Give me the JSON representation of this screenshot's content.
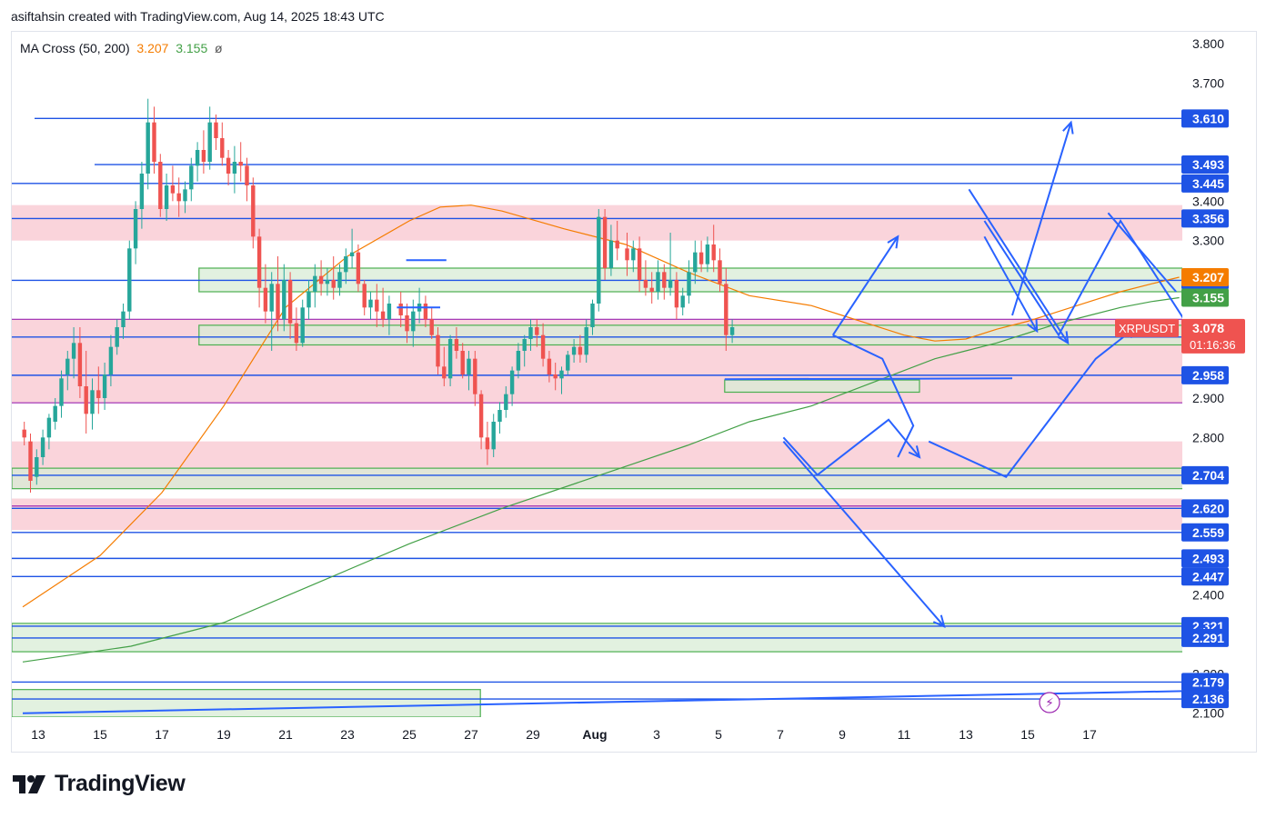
{
  "header": {
    "text": "asiftahsin created with TradingView.com, Aug 14, 2025 18:43 UTC"
  },
  "indicator": {
    "name": "MA Cross (50, 200)",
    "ma50": "3.207",
    "ma200": "3.155",
    "symbol": "ø"
  },
  "brand": {
    "name": "TradingView"
  },
  "colors": {
    "up": "#26a69a",
    "down": "#ef5350",
    "hline": "#1e53e5",
    "ma50": "#f57c00",
    "ma200": "#43a047",
    "redzone": "#f8c6cf",
    "greenzone": "#d8ecd6"
  },
  "chart_data": {
    "type": "candlestick",
    "symbol": "XRPUSDT",
    "last_price": "3.078",
    "countdown": "01:16:36",
    "ylim": [
      2.09,
      3.83
    ],
    "y_ticks": [
      "3.800",
      "3.700",
      "3.400",
      "3.300",
      "2.900",
      "2.800",
      "2.400",
      "2.300",
      "2.200",
      "2.100"
    ],
    "x_ticks": [
      "13",
      "15",
      "17",
      "19",
      "21",
      "23",
      "25",
      "27",
      "29",
      "Aug",
      "3",
      "5",
      "7",
      "9",
      "11",
      "13",
      "15",
      "17"
    ],
    "horizontal_levels": [
      {
        "value": "3.610",
        "y": 3.61
      },
      {
        "value": "3.493",
        "y": 3.493
      },
      {
        "value": "3.445",
        "y": 3.445
      },
      {
        "value": "3.356",
        "y": 3.356
      },
      {
        "value": "3.199",
        "y": 3.199
      },
      {
        "value": "3.055",
        "y": 3.055
      },
      {
        "value": "2.958",
        "y": 2.958
      },
      {
        "value": "2.704",
        "y": 2.704
      },
      {
        "value": "2.620",
        "y": 2.62
      },
      {
        "value": "2.559",
        "y": 2.559
      },
      {
        "value": "2.493",
        "y": 2.493
      },
      {
        "value": "2.447",
        "y": 2.447
      },
      {
        "value": "2.321",
        "y": 2.321
      },
      {
        "value": "2.291",
        "y": 2.291
      },
      {
        "value": "2.179",
        "y": 2.179
      },
      {
        "value": "2.136",
        "y": 2.136
      }
    ],
    "ma_labels": [
      {
        "value": "3.207",
        "y": 3.207,
        "color": "#f57c00"
      },
      {
        "value": "3.155",
        "y": 3.155,
        "color": "#43a047"
      }
    ],
    "zones": [
      {
        "kind": "red",
        "from": 3.3,
        "to": 3.39,
        "x0": 0,
        "x1": 50.8
      },
      {
        "kind": "green",
        "from": 3.17,
        "to": 3.23,
        "x0": 5.2,
        "x1": 50.8
      },
      {
        "kind": "red",
        "from": 2.888,
        "to": 3.1,
        "x0": 0,
        "x1": 50.8
      },
      {
        "kind": "green",
        "from": 3.035,
        "to": 3.085,
        "x0": 5.2,
        "x1": 50.8
      },
      {
        "kind": "green",
        "from": 2.915,
        "to": 2.946,
        "x0": 22.2,
        "x1": 28.5
      },
      {
        "kind": "red",
        "from": 2.67,
        "to": 2.79,
        "x0": 0,
        "x1": 37.6
      },
      {
        "kind": "green",
        "from": 2.67,
        "to": 2.722,
        "x0": 0,
        "x1": 37.6
      },
      {
        "kind": "red",
        "from": 2.565,
        "to": 2.645,
        "x0": 0,
        "x1": 50.8
      },
      {
        "kind": "green",
        "from": 2.256,
        "to": 2.328,
        "x0": 0,
        "x1": 50.8
      },
      {
        "kind": "green",
        "from": 2.09,
        "to": 2.16,
        "x0": 0,
        "x1": 14.3
      }
    ],
    "ma50": [
      [
        -0.5,
        2.37
      ],
      [
        2,
        2.5
      ],
      [
        4,
        2.66
      ],
      [
        6,
        2.88
      ],
      [
        8,
        3.13
      ],
      [
        10,
        3.26
      ],
      [
        12,
        3.35
      ],
      [
        13,
        3.385
      ],
      [
        14,
        3.39
      ],
      [
        15,
        3.375
      ],
      [
        17,
        3.33
      ],
      [
        19,
        3.29
      ],
      [
        21,
        3.22
      ],
      [
        23,
        3.16
      ],
      [
        25,
        3.135
      ],
      [
        26,
        3.11
      ],
      [
        27,
        3.085
      ],
      [
        28,
        3.06
      ],
      [
        29,
        3.045
      ],
      [
        30,
        3.05
      ],
      [
        31,
        3.075
      ],
      [
        32,
        3.095
      ],
      [
        33,
        3.12
      ],
      [
        34,
        3.145
      ],
      [
        35,
        3.17
      ],
      [
        36,
        3.19
      ],
      [
        36.9,
        3.207
      ]
    ],
    "ma200": [
      [
        -0.5,
        2.23
      ],
      [
        3,
        2.27
      ],
      [
        6,
        2.33
      ],
      [
        9,
        2.43
      ],
      [
        12,
        2.53
      ],
      [
        15,
        2.62
      ],
      [
        18,
        2.7
      ],
      [
        21,
        2.78
      ],
      [
        23,
        2.84
      ],
      [
        25,
        2.88
      ],
      [
        26,
        2.91
      ],
      [
        27,
        2.94
      ],
      [
        28,
        2.97
      ],
      [
        29,
        3.0
      ],
      [
        30,
        3.02
      ],
      [
        31,
        3.04
      ],
      [
        32,
        3.065
      ],
      [
        33,
        3.09
      ],
      [
        34,
        3.11
      ],
      [
        35,
        3.13
      ],
      [
        36,
        3.145
      ],
      [
        36.9,
        3.155
      ]
    ],
    "arrows": [
      {
        "kind": "polyline",
        "points": [
          [
            22.2,
            2.948
          ],
          [
            31.5,
            2.95
          ]
        ]
      },
      {
        "kind": "line",
        "points": [
          [
            11.9,
            3.25
          ],
          [
            13.2,
            3.25
          ]
        ]
      },
      {
        "kind": "line",
        "points": [
          [
            11.6,
            3.13
          ],
          [
            13.0,
            3.13
          ]
        ]
      },
      {
        "kind": "polyline",
        "points": [
          [
            24.1,
            2.8
          ],
          [
            25.2,
            2.705
          ],
          [
            27.5,
            2.845
          ],
          [
            28.5,
            2.75
          ]
        ],
        "head": true
      },
      {
        "kind": "polyline",
        "points": [
          [
            25.7,
            3.06
          ],
          [
            27.8,
            3.31
          ]
        ],
        "head": true
      },
      {
        "kind": "polyline",
        "points": [
          [
            27.8,
            2.75
          ],
          [
            28.3,
            2.83
          ],
          [
            27.3,
            3.0
          ],
          [
            25.7,
            3.06
          ]
        ]
      },
      {
        "kind": "polyline",
        "points": [
          [
            28.8,
            2.79
          ],
          [
            31.3,
            2.7
          ],
          [
            34.2,
            3.0
          ],
          [
            35.5,
            3.08
          ]
        ],
        "head": true
      },
      {
        "kind": "polyline",
        "points": [
          [
            30.1,
            3.43
          ],
          [
            33.3,
            3.04
          ]
        ],
        "head": true
      },
      {
        "kind": "polyline",
        "points": [
          [
            31.5,
            3.11
          ],
          [
            33.4,
            3.6
          ]
        ],
        "head": true
      },
      {
        "kind": "polyline",
        "points": [
          [
            30.6,
            3.31
          ],
          [
            32.3,
            3.07
          ]
        ],
        "head": true
      },
      {
        "kind": "polyline",
        "points": [
          [
            30.6,
            3.35
          ],
          [
            33.0,
            3.06
          ],
          [
            35.0,
            3.35
          ],
          [
            37.3,
            3.07
          ],
          [
            38.6,
            3.33
          ]
        ],
        "head": true
      },
      {
        "kind": "polyline",
        "points": [
          [
            34.6,
            3.37
          ],
          [
            36.8,
            3.17
          ]
        ],
        "head": false
      },
      {
        "kind": "polyline",
        "points": [
          [
            24.1,
            2.79
          ],
          [
            29.3,
            2.32
          ]
        ],
        "head": true
      },
      {
        "kind": "line",
        "points": [
          [
            -0.5,
            2.1
          ],
          [
            55,
            2.183
          ]
        ]
      }
    ],
    "candles": [
      [
        2.82,
        2.84,
        2.78,
        2.8
      ],
      [
        2.79,
        2.81,
        2.66,
        2.69
      ],
      [
        2.7,
        2.77,
        2.68,
        2.75
      ],
      [
        2.75,
        2.82,
        2.73,
        2.8
      ],
      [
        2.8,
        2.86,
        2.77,
        2.85
      ],
      [
        2.84,
        2.9,
        2.82,
        2.88
      ],
      [
        2.88,
        2.97,
        2.85,
        2.95
      ],
      [
        2.96,
        3.02,
        2.92,
        3.0
      ],
      [
        3.0,
        3.08,
        2.95,
        3.04
      ],
      [
        3.04,
        3.08,
        2.9,
        2.93
      ],
      [
        2.93,
        3.02,
        2.81,
        2.86
      ],
      [
        2.86,
        2.95,
        2.82,
        2.92
      ],
      [
        2.92,
        2.98,
        2.86,
        2.9
      ],
      [
        2.9,
        2.99,
        2.87,
        2.96
      ],
      [
        2.96,
        3.06,
        2.93,
        3.03
      ],
      [
        3.03,
        3.1,
        3.01,
        3.08
      ],
      [
        3.08,
        3.14,
        3.05,
        3.12
      ],
      [
        3.12,
        3.3,
        3.1,
        3.28
      ],
      [
        3.28,
        3.4,
        3.24,
        3.38
      ],
      [
        3.38,
        3.5,
        3.33,
        3.47
      ],
      [
        3.47,
        3.66,
        3.43,
        3.6
      ],
      [
        3.6,
        3.64,
        3.47,
        3.5
      ],
      [
        3.5,
        3.52,
        3.36,
        3.38
      ],
      [
        3.38,
        3.47,
        3.35,
        3.44
      ],
      [
        3.44,
        3.49,
        3.4,
        3.42
      ],
      [
        3.42,
        3.46,
        3.36,
        3.4
      ],
      [
        3.4,
        3.45,
        3.37,
        3.43
      ],
      [
        3.43,
        3.51,
        3.4,
        3.49
      ],
      [
        3.49,
        3.55,
        3.45,
        3.53
      ],
      [
        3.53,
        3.58,
        3.47,
        3.5
      ],
      [
        3.5,
        3.64,
        3.48,
        3.6
      ],
      [
        3.6,
        3.62,
        3.53,
        3.56
      ],
      [
        3.56,
        3.6,
        3.49,
        3.51
      ],
      [
        3.51,
        3.53,
        3.44,
        3.47
      ],
      [
        3.47,
        3.54,
        3.42,
        3.5
      ],
      [
        3.5,
        3.55,
        3.45,
        3.49
      ],
      [
        3.49,
        3.51,
        3.4,
        3.44
      ],
      [
        3.44,
        3.46,
        3.28,
        3.31
      ],
      [
        3.31,
        3.33,
        3.13,
        3.18
      ],
      [
        3.18,
        3.24,
        3.09,
        3.12
      ],
      [
        3.12,
        3.22,
        3.02,
        3.19
      ],
      [
        3.19,
        3.26,
        3.07,
        3.1
      ],
      [
        3.1,
        3.24,
        3.07,
        3.2
      ],
      [
        3.2,
        3.22,
        3.05,
        3.09
      ],
      [
        3.09,
        3.13,
        3.02,
        3.04
      ],
      [
        3.04,
        3.15,
        3.03,
        3.13
      ],
      [
        3.13,
        3.2,
        3.1,
        3.17
      ],
      [
        3.17,
        3.24,
        3.13,
        3.21
      ],
      [
        3.21,
        3.25,
        3.16,
        3.19
      ],
      [
        3.19,
        3.23,
        3.16,
        3.2
      ],
      [
        3.2,
        3.26,
        3.15,
        3.18
      ],
      [
        3.18,
        3.24,
        3.16,
        3.22
      ],
      [
        3.22,
        3.28,
        3.19,
        3.26
      ],
      [
        3.26,
        3.33,
        3.23,
        3.27
      ],
      [
        3.27,
        3.29,
        3.17,
        3.19
      ],
      [
        3.19,
        3.2,
        3.11,
        3.13
      ],
      [
        3.13,
        3.17,
        3.1,
        3.15
      ],
      [
        3.15,
        3.19,
        3.08,
        3.12
      ],
      [
        3.12,
        3.18,
        3.08,
        3.1
      ],
      [
        3.1,
        3.16,
        3.06,
        3.14
      ],
      [
        3.14,
        3.17,
        3.08,
        3.11
      ],
      [
        3.11,
        3.14,
        3.04,
        3.07
      ],
      [
        3.07,
        3.15,
        3.03,
        3.12
      ],
      [
        3.12,
        3.18,
        3.09,
        3.14
      ],
      [
        3.14,
        3.16,
        3.08,
        3.1
      ],
      [
        3.1,
        3.13,
        3.05,
        3.06
      ],
      [
        3.06,
        3.08,
        2.96,
        2.98
      ],
      [
        2.98,
        3.03,
        2.93,
        2.95
      ],
      [
        2.95,
        3.06,
        2.93,
        3.05
      ],
      [
        3.05,
        3.08,
        3.0,
        3.02
      ],
      [
        3.02,
        3.04,
        2.95,
        2.96
      ],
      [
        2.96,
        3.02,
        2.92,
        3.0
      ],
      [
        3.0,
        3.02,
        2.88,
        2.91
      ],
      [
        2.91,
        2.92,
        2.77,
        2.8
      ],
      [
        2.8,
        2.84,
        2.73,
        2.77
      ],
      [
        2.77,
        2.86,
        2.75,
        2.84
      ],
      [
        2.84,
        2.89,
        2.81,
        2.87
      ],
      [
        2.87,
        2.93,
        2.85,
        2.91
      ],
      [
        2.91,
        2.98,
        2.88,
        2.97
      ],
      [
        2.97,
        3.04,
        2.95,
        3.02
      ],
      [
        3.02,
        3.06,
        2.98,
        3.05
      ],
      [
        3.05,
        3.1,
        3.02,
        3.08
      ],
      [
        3.08,
        3.1,
        3.03,
        3.06
      ],
      [
        3.06,
        3.09,
        2.98,
        3.0
      ],
      [
        3.0,
        3.02,
        2.94,
        2.96
      ],
      [
        2.96,
        2.99,
        2.92,
        2.95
      ],
      [
        2.95,
        2.98,
        2.91,
        2.97
      ],
      [
        2.97,
        3.02,
        2.96,
        3.01
      ],
      [
        3.01,
        3.05,
        2.99,
        3.03
      ],
      [
        3.03,
        3.06,
        2.99,
        3.01
      ],
      [
        3.01,
        3.1,
        2.99,
        3.08
      ],
      [
        3.08,
        3.15,
        3.06,
        3.14
      ],
      [
        3.14,
        3.38,
        3.12,
        3.36
      ],
      [
        3.36,
        3.38,
        3.2,
        3.23
      ],
      [
        3.23,
        3.34,
        3.21,
        3.3
      ],
      [
        3.3,
        3.35,
        3.25,
        3.28
      ],
      [
        3.28,
        3.32,
        3.21,
        3.25
      ],
      [
        3.25,
        3.3,
        3.22,
        3.28
      ],
      [
        3.28,
        3.31,
        3.17,
        3.2
      ],
      [
        3.2,
        3.25,
        3.16,
        3.18
      ],
      [
        3.18,
        3.22,
        3.14,
        3.17
      ],
      [
        3.17,
        3.25,
        3.15,
        3.22
      ],
      [
        3.22,
        3.24,
        3.15,
        3.18
      ],
      [
        3.18,
        3.32,
        3.16,
        3.2
      ],
      [
        3.2,
        3.22,
        3.1,
        3.13
      ],
      [
        3.13,
        3.18,
        3.11,
        3.16
      ],
      [
        3.16,
        3.25,
        3.14,
        3.22
      ],
      [
        3.22,
        3.3,
        3.19,
        3.27
      ],
      [
        3.27,
        3.3,
        3.22,
        3.24
      ],
      [
        3.24,
        3.31,
        3.22,
        3.29
      ],
      [
        3.29,
        3.34,
        3.22,
        3.25
      ],
      [
        3.25,
        3.28,
        3.17,
        3.19
      ],
      [
        3.19,
        3.23,
        3.02,
        3.06
      ],
      [
        3.06,
        3.1,
        3.04,
        3.08
      ]
    ],
    "candle_x0": -0.45,
    "candle_step": 0.2
  }
}
